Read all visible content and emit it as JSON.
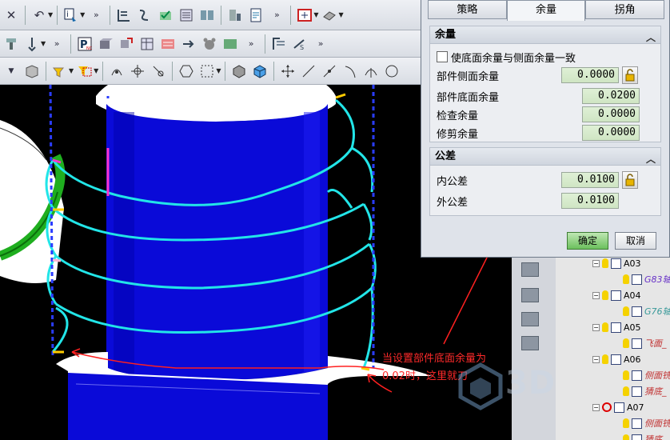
{
  "dialog": {
    "tabs": [
      "策略",
      "余量",
      "拐角"
    ],
    "active_tab": "余量",
    "allowance_group": {
      "title": "余量",
      "same_allowance_checkbox": "使底面余量与侧面余量一致",
      "part_side_label": "部件侧面余量",
      "part_side_value": "0.0000",
      "part_floor_label": "部件底面余量",
      "part_floor_value": "0.0200",
      "check_label": "检查余量",
      "check_value": "0.0000",
      "trim_label": "修剪余量",
      "trim_value": "0.0000"
    },
    "tolerance_group": {
      "title": "公差",
      "intol_label": "内公差",
      "intol_value": "0.0100",
      "outtol_label": "外公差",
      "outtol_value": "0.0100"
    },
    "ok_label": "确定",
    "cancel_label": "取消"
  },
  "annotation": {
    "line1": "当设置部件底面余量为",
    "line2": "0.02时，这里就刀"
  },
  "watermark": "3D",
  "tree": [
    {
      "name": "A03",
      "indent": 1,
      "type": "group"
    },
    {
      "name": "G83轴",
      "indent": 2,
      "type": "op",
      "color": "#6a35c8"
    },
    {
      "name": "A04",
      "indent": 1,
      "type": "group"
    },
    {
      "name": "G76轴",
      "indent": 2,
      "type": "op",
      "color": "#3a9a9a"
    },
    {
      "name": "A05",
      "indent": 1,
      "type": "group"
    },
    {
      "name": "飞面_",
      "indent": 2,
      "type": "op",
      "color": "#c03030"
    },
    {
      "name": "A06",
      "indent": 1,
      "type": "group"
    },
    {
      "name": "侧面铣",
      "indent": 2,
      "type": "op",
      "color": "#c03030"
    },
    {
      "name": "猜底_",
      "indent": 2,
      "type": "op",
      "color": "#c03030"
    },
    {
      "name": "A07",
      "indent": 1,
      "type": "stopgroup"
    },
    {
      "name": "侧面铣",
      "indent": 2,
      "type": "op",
      "color": "#c03030"
    },
    {
      "name": "猜底_",
      "indent": 2,
      "type": "op",
      "color": "#c03030"
    }
  ]
}
